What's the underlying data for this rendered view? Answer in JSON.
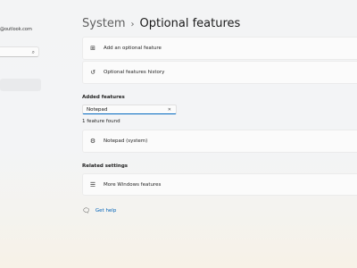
{
  "nav": {
    "account_email": "@outlook.com",
    "search_icon": "search-icon"
  },
  "header": {
    "parent": "System",
    "separator": "›",
    "title": "Optional features"
  },
  "actions": {
    "add_feature": {
      "label": "Add an optional feature",
      "icon": "add-feature-icon"
    },
    "history": {
      "label": "Optional features history",
      "icon": "history-icon"
    }
  },
  "added_features": {
    "heading": "Added features",
    "filter_value": "Notepad",
    "clear_icon": "close-icon",
    "result_count": "1 feature found",
    "items": [
      {
        "label": "Notepad (system)",
        "icon": "gear-icon"
      }
    ]
  },
  "related": {
    "heading": "Related settings",
    "items": [
      {
        "label": "More Windows features",
        "icon": "list-icon"
      }
    ]
  },
  "help": {
    "label": "Get help",
    "icon": "help-icon"
  }
}
